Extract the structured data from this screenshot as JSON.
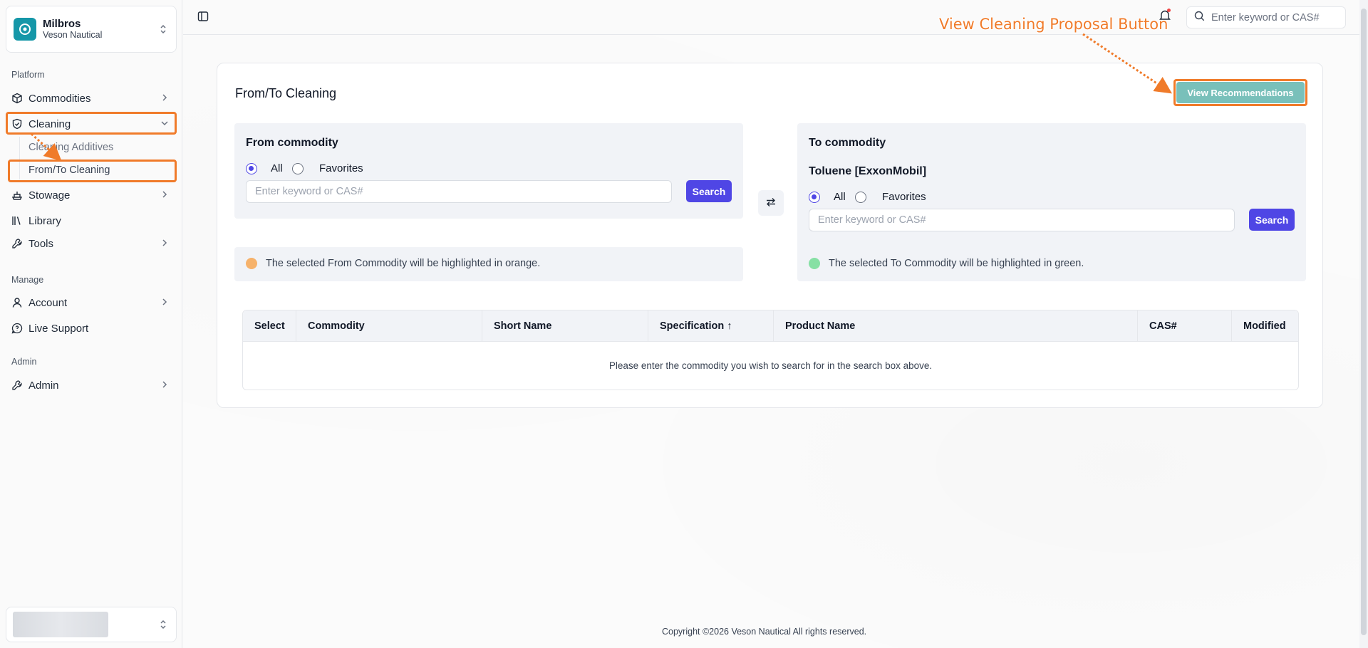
{
  "org": {
    "name": "Milbros",
    "subtitle": "Veson Nautical"
  },
  "sidebar": {
    "platform_label": "Platform",
    "manage_label": "Manage",
    "admin_label": "Admin",
    "items": [
      {
        "label": "Commodities"
      },
      {
        "label": "Cleaning"
      },
      {
        "label": "Cleaning Additives"
      },
      {
        "label": "From/To Cleaning"
      },
      {
        "label": "Stowage"
      },
      {
        "label": "Library"
      },
      {
        "label": "Tools"
      },
      {
        "label": "Account"
      },
      {
        "label": "Live Support"
      },
      {
        "label": "Admin"
      }
    ]
  },
  "topbar": {
    "search_placeholder": "Enter keyword or CAS#"
  },
  "page": {
    "title": "From/To Cleaning",
    "view_button": "View Recommendations",
    "annotation": "View Cleaning Proposal Button"
  },
  "from": {
    "title": "From commodity",
    "radio_all": "All",
    "radio_favorites": "Favorites",
    "placeholder": "Enter keyword or CAS#",
    "search": "Search",
    "hint": "The selected From Commodity will be highlighted in orange.",
    "hint_color": "#f6b26b"
  },
  "to": {
    "title": "To commodity",
    "selected": "Toluene [ExxonMobil]",
    "radio_all": "All",
    "radio_favorites": "Favorites",
    "placeholder": "Enter keyword or CAS#",
    "search": "Search",
    "hint": "The selected To Commodity will be highlighted in green.",
    "hint_color": "#86e0a4"
  },
  "table": {
    "headers": [
      "Select",
      "Commodity",
      "Short Name",
      "Specification ↑",
      "Product Name",
      "CAS#",
      "Modified"
    ],
    "empty_message": "Please enter the commodity you wish to search for in the search box above."
  },
  "footer": "Copyright ©2026 Veson Nautical All rights reserved.",
  "colors": {
    "accent": "#4f46e5",
    "teal_button": "#79c0ba",
    "annotation": "#f07b2a"
  }
}
